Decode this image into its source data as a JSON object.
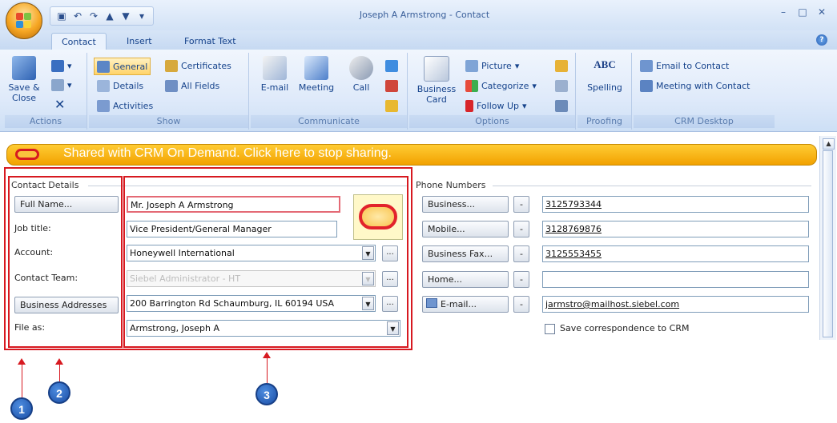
{
  "window": {
    "title": "Joseph A Armstrong - Contact"
  },
  "ribbon": {
    "tabs": [
      "Contact",
      "Insert",
      "Format Text"
    ],
    "groups": {
      "actions": {
        "label": "Actions",
        "save_close": "Save & Close"
      },
      "show": {
        "label": "Show",
        "general": "General",
        "details": "Details",
        "activities": "Activities",
        "certificates": "Certificates",
        "all_fields": "All Fields"
      },
      "communicate": {
        "label": "Communicate",
        "email": "E-mail",
        "meeting": "Meeting",
        "call": "Call"
      },
      "options": {
        "label": "Options",
        "business_card": "Business Card",
        "picture": "Picture",
        "categorize": "Categorize",
        "follow_up": "Follow Up"
      },
      "proofing": {
        "label": "Proofing",
        "spelling": "Spelling"
      },
      "crm": {
        "label": "CRM Desktop",
        "email_to_contact": "Email to Contact",
        "meeting_with_contact": "Meeting with Contact"
      }
    }
  },
  "banner": {
    "text": "Shared with CRM On Demand. Click here to stop sharing."
  },
  "contact_details": {
    "section_label": "Contact Details",
    "full_name_button": "Full Name...",
    "full_name": "Mr. Joseph A Armstrong",
    "job_title_label": "Job title:",
    "job_title": "Vice President/General  Manager",
    "account_label": "Account:",
    "account": "Honeywell International",
    "contact_team_label": "Contact Team:",
    "contact_team": "Siebel Administrator - HT",
    "business_addresses_button": "Business Addresses",
    "address": "200 Barrington Rd Schaumburg, IL 60194 USA",
    "file_as_label": "File as:",
    "file_as": "Armstrong, Joseph A"
  },
  "phone_numbers": {
    "section_label": "Phone Numbers",
    "rows": [
      {
        "label": "Business...",
        "value": "3125793344"
      },
      {
        "label": "Mobile...",
        "value": "3128769876"
      },
      {
        "label": "Business Fax...",
        "value": "3125553455"
      },
      {
        "label": "Home...",
        "value": ""
      }
    ],
    "email_button": "E-mail...",
    "email": "jarmstro@mailhost.siebel.com",
    "save_correspondence": "Save correspondence to CRM"
  },
  "callouts": [
    "1",
    "2",
    "3"
  ],
  "colors": {
    "callout_red": "#d71920",
    "banner_orange": "#f2a100",
    "badge_blue": "#1a4ea6"
  }
}
